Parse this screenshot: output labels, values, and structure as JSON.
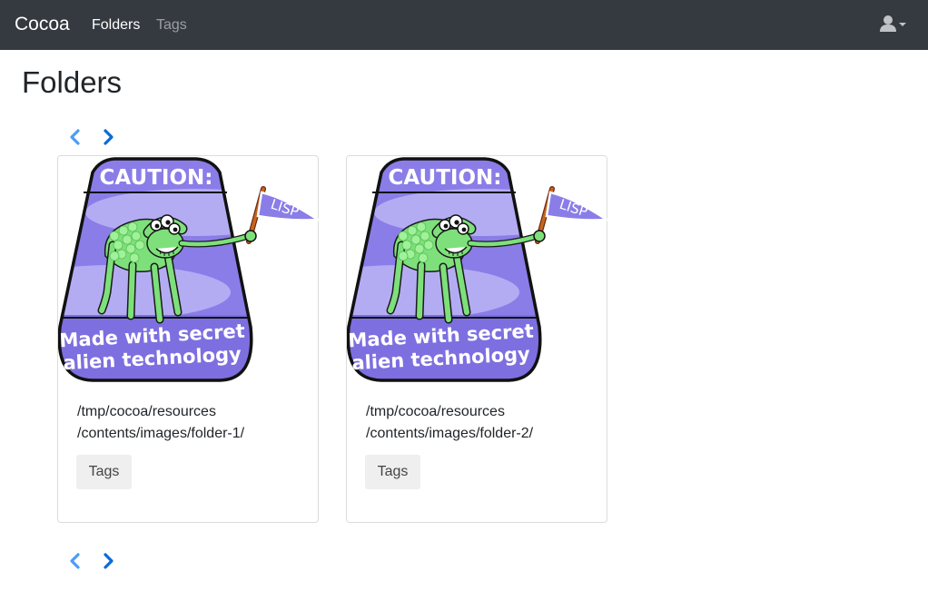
{
  "navbar": {
    "brand": "Cocoa",
    "links": [
      {
        "label": "Folders",
        "active": true
      },
      {
        "label": "Tags",
        "active": false
      }
    ],
    "user_menu_icon": "user-icon",
    "user_menu_caret": "caret-down-icon"
  },
  "page": {
    "title": "Folders"
  },
  "pagination": {
    "prev_icon": "chevron-left-icon",
    "next_icon": "chevron-right-icon"
  },
  "folders": [
    {
      "path_line1": "/tmp/cocoa/resources",
      "path_line2": "/contents/images/folder-1/",
      "tags_label": "Tags",
      "image": {
        "caution": "CAUTION:",
        "flag": "LISP",
        "line1": "Made with secret",
        "line2": "alien technology"
      }
    },
    {
      "path_line1": "/tmp/cocoa/resources",
      "path_line2": "/contents/images/folder-2/",
      "tags_label": "Tags",
      "image": {
        "caution": "CAUTION:",
        "flag": "LISP",
        "line1": "Made with secret",
        "line2": "alien technology"
      }
    }
  ],
  "colors": {
    "navbar_bg": "#343a40",
    "link_blue": "#007bff",
    "badge_purple": "#8a7de8",
    "creature_green": "#7ee07a"
  }
}
